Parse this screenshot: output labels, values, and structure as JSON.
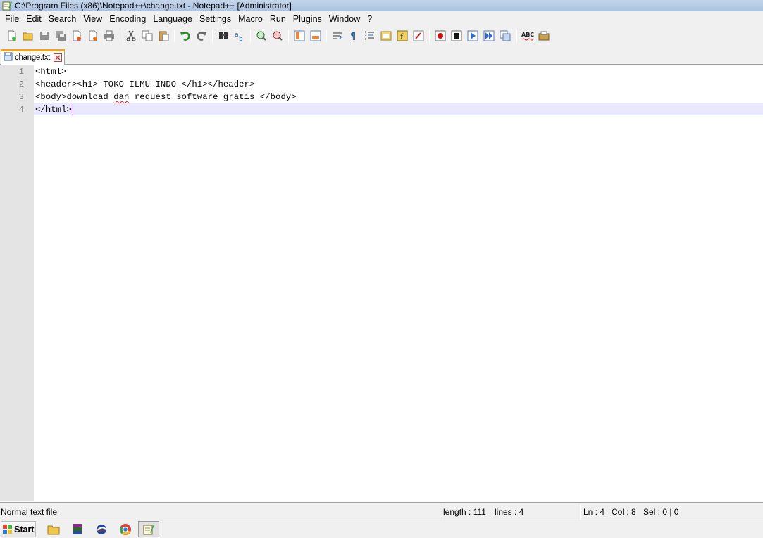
{
  "window": {
    "title": "C:\\Program Files (x86)\\Notepad++\\change.txt - Notepad++ [Administrator]"
  },
  "menu": {
    "items": [
      "File",
      "Edit",
      "Search",
      "View",
      "Encoding",
      "Language",
      "Settings",
      "Macro",
      "Run",
      "Plugins",
      "Window",
      "?"
    ]
  },
  "toolbar": {
    "buttons": [
      "new-file-icon",
      "open-file-icon",
      "save-icon",
      "save-all-icon",
      "close-icon",
      "close-all-icon",
      "print-icon",
      "cut-icon",
      "copy-icon",
      "paste-icon",
      "undo-icon",
      "redo-icon",
      "find-icon",
      "replace-icon",
      "zoom-in-icon",
      "zoom-out-icon",
      "sync-vertical-icon",
      "sync-horizontal-icon",
      "word-wrap-icon",
      "show-all-chars-icon",
      "indent-guide-icon",
      "document-map-icon",
      "function-list-icon",
      "folder-workspace-icon",
      "record-macro-icon",
      "stop-record-icon",
      "play-macro-icon",
      "run-macro-multiple-icon",
      "save-macro-icon",
      "spell-check-icon",
      "plugin-icon"
    ]
  },
  "tab": {
    "label": "change.txt"
  },
  "editor": {
    "line_numbers": [
      "1",
      "2",
      "3",
      "4"
    ],
    "lines": {
      "l1": "<html>",
      "l2": "<header><h1> TOKO ILMU INDO </h1></header>",
      "l3_before": "<body>download ",
      "l3_misspelled": "dan",
      "l3_after": " request software gratis </body>",
      "l4": "</html>"
    }
  },
  "status": {
    "file_type": "Normal text file",
    "length": "length : 111",
    "lines": "lines : 4",
    "ln": "Ln : 4",
    "col": "Col : 8",
    "sel": "Sel : 0 | 0"
  },
  "taskbar": {
    "start_label": "Start",
    "items": [
      "explorer-folder-icon",
      "winrar-icon",
      "network-icon",
      "chrome-icon",
      "notepad-plus-plus-icon"
    ]
  },
  "colors": {
    "current_line": "#e8e8ff",
    "caret": "#8000ff",
    "tab_accent": "#f7a21b",
    "gutter": "#e4e4e4"
  }
}
